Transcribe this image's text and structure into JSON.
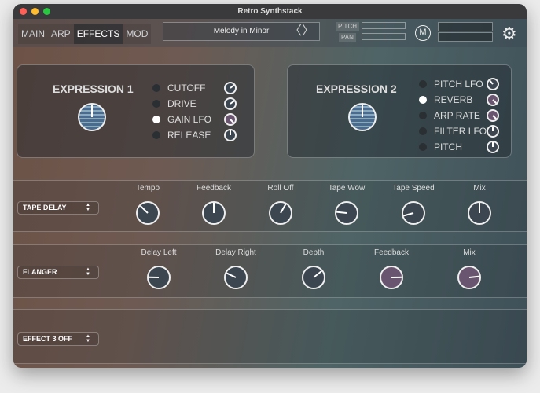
{
  "window": {
    "title": "Retro Synthstack"
  },
  "tabs": [
    {
      "label": "MAIN"
    },
    {
      "label": "ARP"
    },
    {
      "label": "EFFECTS",
      "active": true
    },
    {
      "label": "MOD"
    }
  ],
  "preset": {
    "name": "Melody in Minor",
    "prev": "〈",
    "next": "〉"
  },
  "sliders": {
    "pitch_label": "PITCH",
    "pan_label": "PAN",
    "pitch_value": 0.5,
    "pan_value": 0.5
  },
  "m_button": "M",
  "settings_icon": "gear-icon",
  "colors": {
    "accent_purple": "#6a5570",
    "knob_dark": "#3b4650"
  },
  "expression1": {
    "title": "EXPRESSION 1",
    "value": 0.5,
    "targets": [
      {
        "label": "CUTOFF",
        "active": false,
        "value": 0.69,
        "purple": false
      },
      {
        "label": "DRIVE",
        "active": false,
        "value": 0.7,
        "purple": false
      },
      {
        "label": "GAIN LFO",
        "active": true,
        "value": 1.0,
        "purple": true
      },
      {
        "label": "RELEASE",
        "active": false,
        "value": 0.5,
        "purple": false
      }
    ]
  },
  "expression2": {
    "title": "EXPRESSION 2",
    "value": 0.5,
    "targets": [
      {
        "label": "PITCH LFO",
        "active": false,
        "value": 0.35,
        "purple": false
      },
      {
        "label": "REVERB",
        "active": true,
        "value": 1.0,
        "purple": true
      },
      {
        "label": "ARP RATE",
        "active": false,
        "value": 1.0,
        "purple": true
      },
      {
        "label": "FILTER LFO",
        "active": false,
        "value": 0.5,
        "purple": false
      },
      {
        "label": "PITCH",
        "active": false,
        "value": 0.5,
        "purple": false
      }
    ]
  },
  "effects": [
    {
      "name": "TAPE DELAY",
      "knobs": [
        {
          "label": "Tempo",
          "value": 0.33
        },
        {
          "label": "Feedback",
          "value": 0.5
        },
        {
          "label": "Roll Off",
          "value": 0.61
        },
        {
          "label": "Tape Wow",
          "value": 0.19
        },
        {
          "label": "Tape Speed",
          "value": 0.11
        },
        {
          "label": "Mix",
          "value": 0.5
        }
      ]
    },
    {
      "name": "FLANGER",
      "knobs": [
        {
          "label": "Delay Left",
          "value": 0.17
        },
        {
          "label": "Delay Right",
          "value": 0.26
        },
        {
          "label": "Depth",
          "value": 0.69
        },
        {
          "label": "Feedback",
          "value": 0.83,
          "purple": true
        },
        {
          "label": "Mix",
          "value": 0.81,
          "purple": true
        }
      ]
    },
    {
      "name": "EFFECT 3 OFF",
      "knobs": []
    }
  ]
}
